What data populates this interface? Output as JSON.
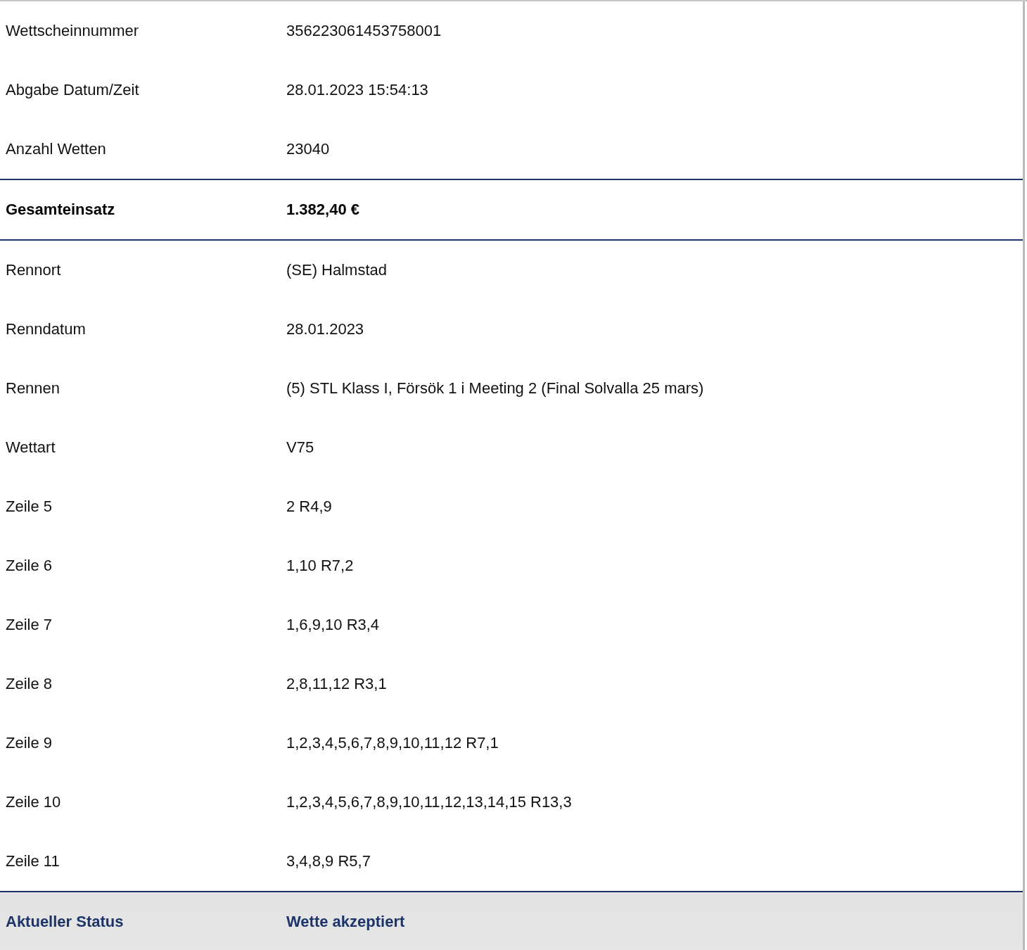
{
  "sections": [
    {
      "kind": "plain",
      "rows": [
        {
          "label": "Wettscheinnummer",
          "value": "356223061453758001"
        },
        {
          "label": "Abgabe Datum/Zeit",
          "value": "28.01.2023 15:54:13"
        },
        {
          "label": "Anzahl Wetten",
          "value": "23040"
        }
      ]
    },
    {
      "kind": "total",
      "rows": [
        {
          "label": "Gesamteinsatz",
          "value": "1.382,40 €"
        }
      ]
    },
    {
      "kind": "plain",
      "rows": [
        {
          "label": "Rennort",
          "value": "(SE) Halmstad"
        },
        {
          "label": "Renndatum",
          "value": "28.01.2023"
        },
        {
          "label": "Rennen",
          "value": "(5) STL Klass I, Försök 1 i Meeting 2 (Final Solvalla 25 mars)"
        },
        {
          "label": "Wettart",
          "value": "V75"
        },
        {
          "label": "Zeile 5",
          "value": "2 R4,9"
        },
        {
          "label": "Zeile 6",
          "value": "1,10 R7,2"
        },
        {
          "label": "Zeile 7",
          "value": "1,6,9,10 R3,4"
        },
        {
          "label": "Zeile 8",
          "value": "2,8,11,12 R3,1"
        },
        {
          "label": "Zeile 9",
          "value": "1,2,3,4,5,6,7,8,9,10,11,12 R7,1"
        },
        {
          "label": "Zeile 10",
          "value": "1,2,3,4,5,6,7,8,9,10,11,12,13,14,15 R13,3"
        },
        {
          "label": "Zeile 11",
          "value": "3,4,8,9 R5,7"
        }
      ]
    },
    {
      "kind": "status",
      "rows": [
        {
          "label": "Aktueller Status",
          "value": "Wette akzeptiert"
        }
      ]
    }
  ]
}
